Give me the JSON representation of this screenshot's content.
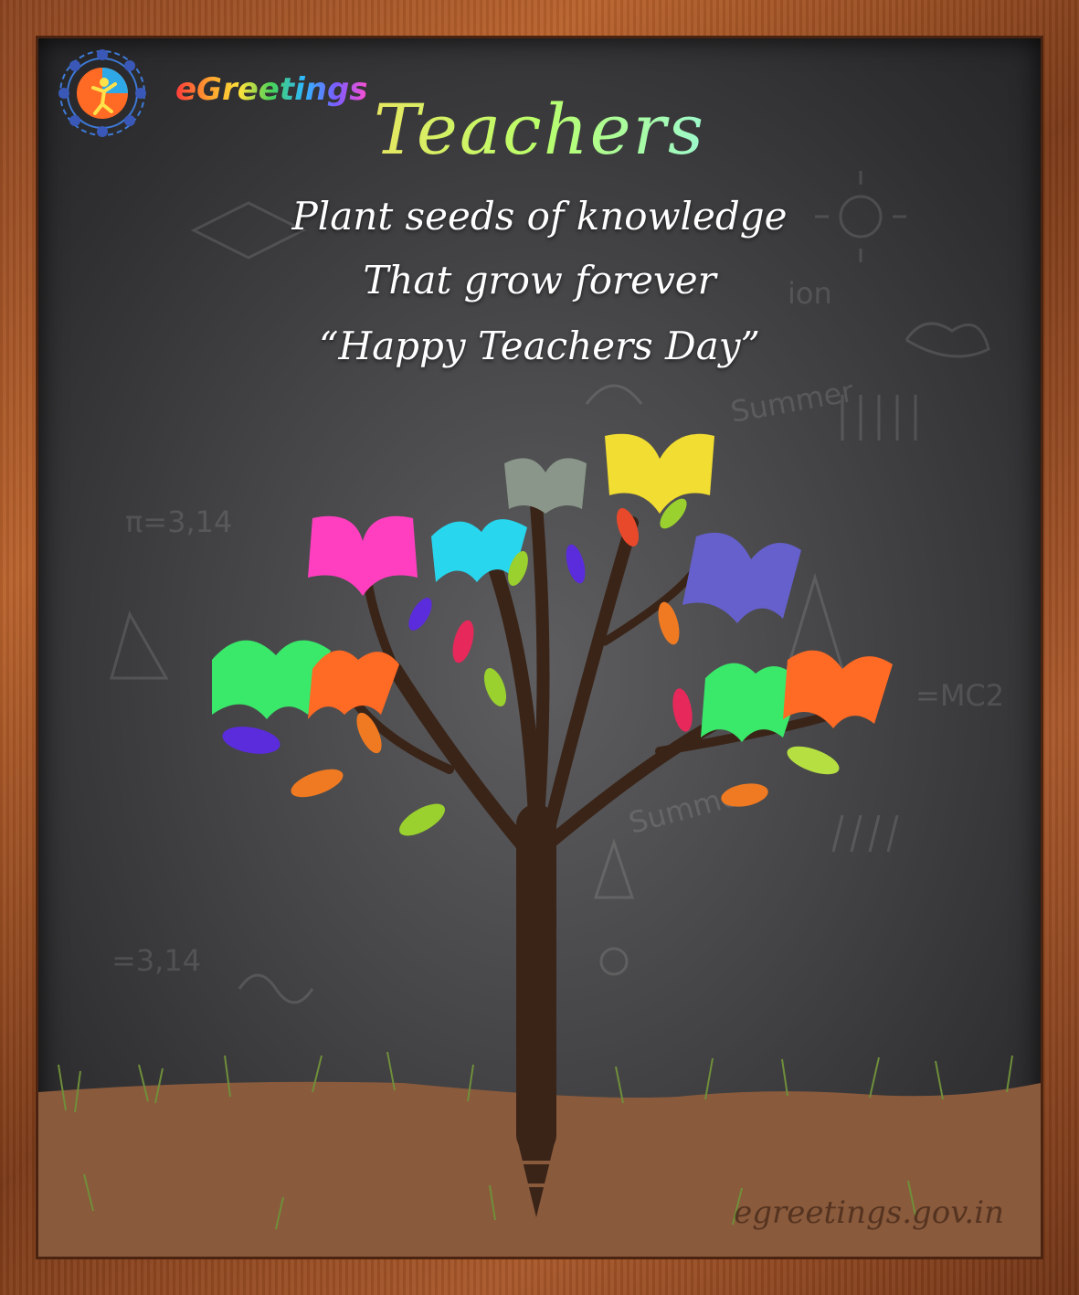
{
  "brand": {
    "name": "eGreetings"
  },
  "card": {
    "title": "Teachers",
    "line1": "Plant seeds of knowledge",
    "line2": "That grow forever",
    "line3": "“Happy Teachers Day”"
  },
  "footer": {
    "watermark": "egreetings.gov.in"
  },
  "colors": {
    "board": "#3f3f41",
    "frame": "#a0522d",
    "soil": "#8a5a3c",
    "trunk": "#3a2418"
  }
}
